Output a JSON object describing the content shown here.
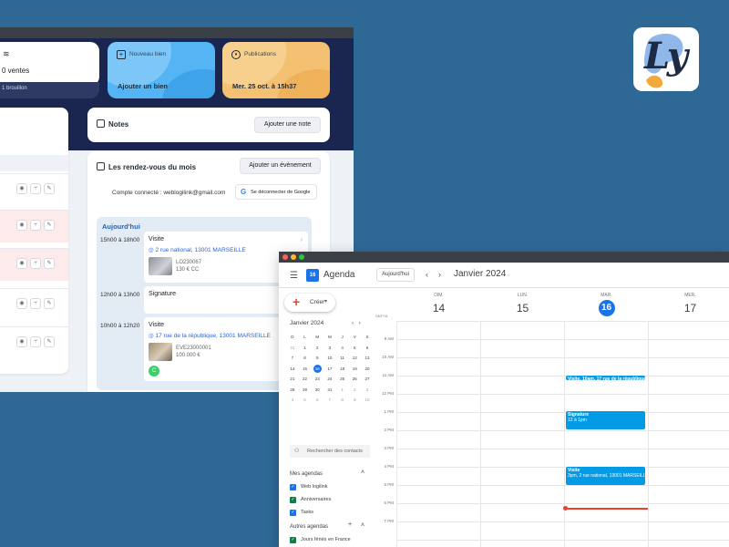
{
  "crm": {
    "card_ventes": {
      "value": "0 ventes",
      "footer": "1 brouillon"
    },
    "card_bien": {
      "title": "Nouveau bien",
      "action": "Ajouter un bien"
    },
    "card_publications": {
      "title": "Publications",
      "value": "Mer. 25 oct. à 15h37"
    },
    "notes": {
      "title": "Notes",
      "add_button": "Ajouter une note"
    },
    "rdv": {
      "title": "Les rendez-vous du mois",
      "add_button": "Ajouter un évènement",
      "account_label": "Compte connecté : weblogilink@gmail.com",
      "logout_button": "Se déconnecter de Google",
      "day_label": "Aujourd'hui",
      "slots": [
        {
          "time": "15h00 à 18h00",
          "title": "Visite",
          "address": "2 rue national, 13001 MARSEILLE",
          "ref": "LO230067",
          "price": "130 € CC"
        },
        {
          "time": "12h00 à 13h00",
          "title": "Signature"
        },
        {
          "time": "10h00 à 12h20",
          "title": "Visite",
          "address": "17 rue de la république, 13001 MARSEILLE",
          "ref": "EVE23000001",
          "price": "100.000 €"
        }
      ],
      "status_badge": "C"
    }
  },
  "calendar": {
    "app_title": "Agenda",
    "app_icon_day": "16",
    "today_button": "Aujourd'hui",
    "month_title": "Janvier 2024",
    "create_button": "Créer",
    "mini_month": "Janvier 2024",
    "weekday_initials": [
      "D",
      "L",
      "M",
      "M",
      "J",
      "V",
      "S"
    ],
    "mini_weeks": [
      [
        "31",
        "1",
        "2",
        "3",
        "4",
        "5",
        "6"
      ],
      [
        "7",
        "8",
        "9",
        "10",
        "11",
        "12",
        "13"
      ],
      [
        "14",
        "15",
        "16",
        "17",
        "18",
        "19",
        "20"
      ],
      [
        "21",
        "22",
        "23",
        "24",
        "25",
        "26",
        "27"
      ],
      [
        "28",
        "29",
        "30",
        "31",
        "1",
        "2",
        "3"
      ],
      [
        "4",
        "5",
        "6",
        "7",
        "8",
        "9",
        "10"
      ]
    ],
    "mini_selected": "16",
    "search_people": "Rechercher des contacts",
    "my_calendars_title": "Mes agendas",
    "my_calendars": [
      {
        "label": "Web logilink",
        "color": "#1a73e8"
      },
      {
        "label": "Anniversaires",
        "color": "#0b8043"
      },
      {
        "label": "Tasks",
        "color": "#1a73e8"
      }
    ],
    "other_calendars_title": "Autres agendas",
    "other_calendars": [
      {
        "label": "Jours fériés en France",
        "color": "#0b8043"
      }
    ],
    "timezone": "GMT+01",
    "columns": [
      {
        "weekday": "DIM.",
        "day": "14",
        "today": false
      },
      {
        "weekday": "LUN.",
        "day": "15",
        "today": false
      },
      {
        "weekday": "MAR.",
        "day": "16",
        "today": true
      },
      {
        "weekday": "MER.",
        "day": "17",
        "today": false
      }
    ],
    "hours": [
      "9 AM",
      "10 AM",
      "11 AM",
      "12 PM",
      "1 PM",
      "2 PM",
      "3 PM",
      "4 PM",
      "5 PM",
      "6 PM",
      "7 PM"
    ],
    "events": [
      {
        "label": "Visite, 10am, 17 rue de la république, 13...",
        "sub": ""
      },
      {
        "label": "Signature",
        "sub": "12 à 1pm"
      },
      {
        "label": "Visite",
        "sub": "3pm, 2 rue national, 13001 MARSEILL..."
      }
    ],
    "event_color": "#039be5",
    "now_color": "#ea4335"
  }
}
